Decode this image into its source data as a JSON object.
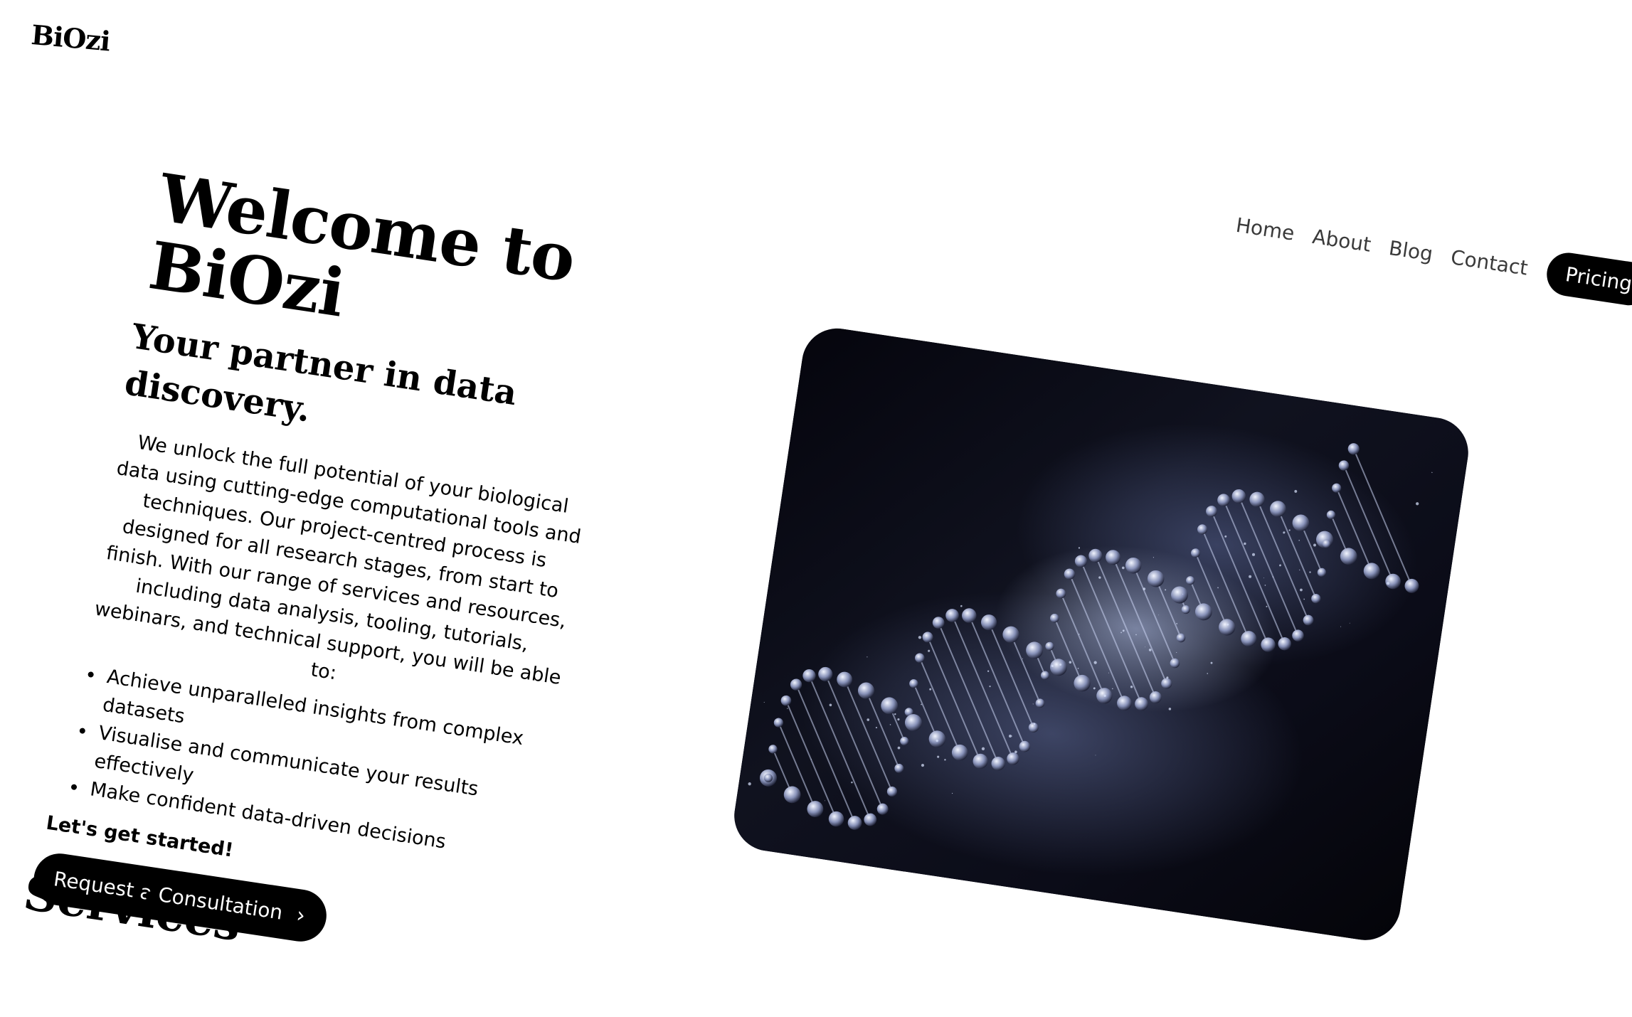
{
  "brand": {
    "logo": "BiOzi"
  },
  "nav": {
    "links": [
      "Home",
      "About",
      "Blog",
      "Contact"
    ],
    "cta": "Pricing"
  },
  "hero": {
    "title_line1": "Welcome to",
    "title_line2": "BiOzi",
    "subtitle": "Your partner in data discovery.",
    "description": "We unlock the full potential of your biological data using cutting-edge computational tools and techniques. Our project-centred process is designed for all research stages, from start to finish. With our range of services and resources, including data analysis, tooling, tutorials, webinars, and technical support, you will be able to:",
    "bullets": [
      "Achieve unparalleled insights from complex datasets",
      "Visualise and communicate your results effectively",
      "Make confident data-driven decisions"
    ],
    "started": "Let's get started!",
    "cta_label": "Request a Consultation",
    "cta_icon": "chevron-right-icon",
    "image": "dna-helix-illustration"
  },
  "sections": {
    "services_title": "Services"
  },
  "colors": {
    "primary": "#000000",
    "background": "#ffffff",
    "nav_text": "#3a3a3a",
    "image_dark": "#0b0c18",
    "image_glow": "#c8d7ff"
  }
}
